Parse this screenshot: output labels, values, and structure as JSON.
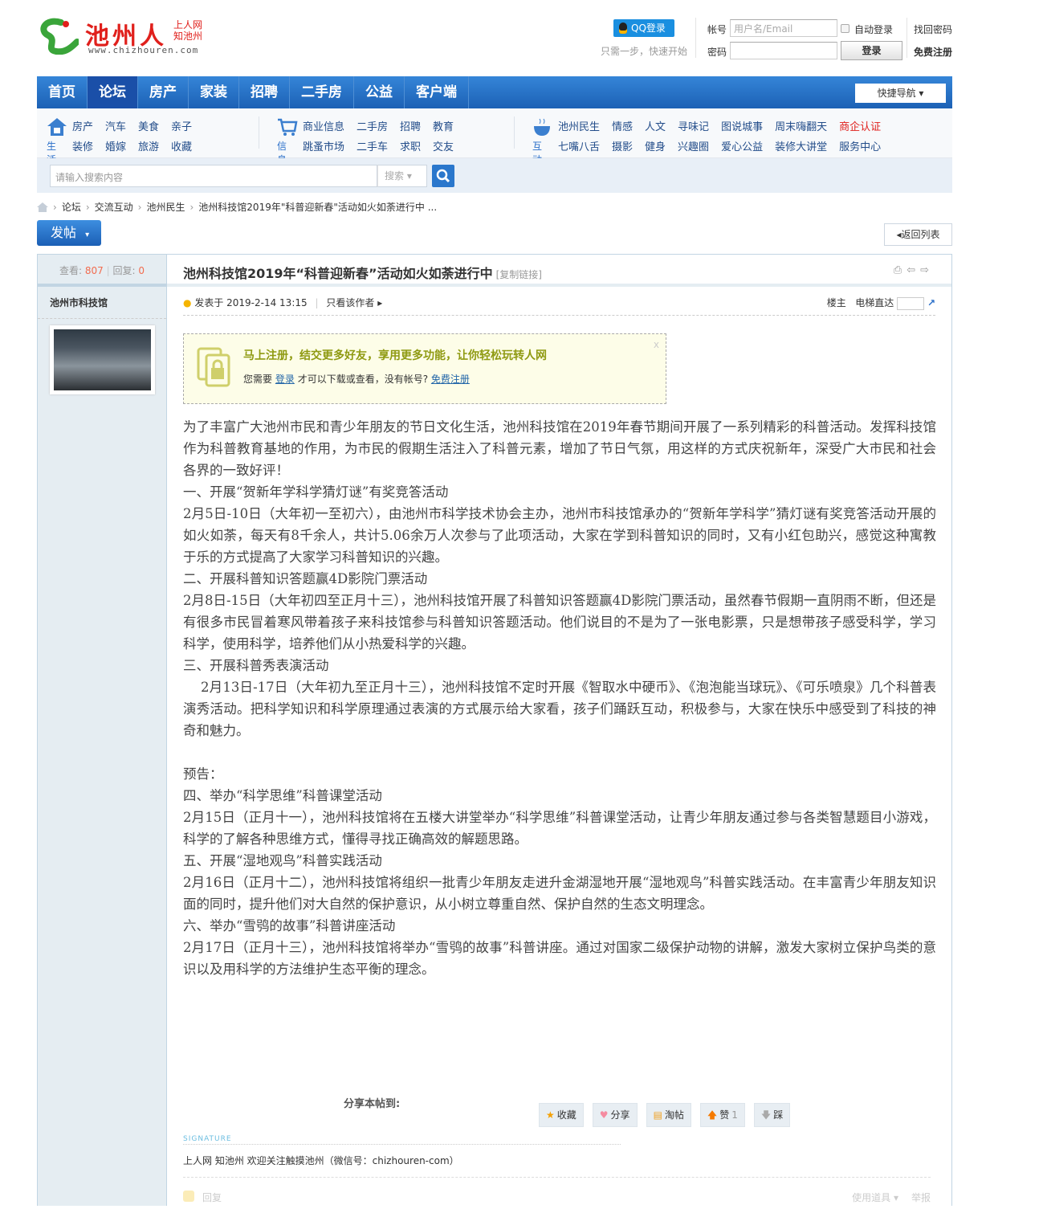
{
  "logo": {
    "name": "池州人",
    "sub1": "上人网",
    "sub2": "知池州",
    "url": "www.chizhouren.com"
  },
  "login": {
    "qq_label": "QQ登录",
    "qq_tip": "只需一步，快速开始",
    "account_label": "帐号",
    "account_placeholder": "用户名/Email",
    "password_label": "密码",
    "auto_login": "自动登录",
    "login_btn": "登录",
    "find_pwd": "找回密码",
    "register": "免费注册"
  },
  "nav": {
    "items": [
      "首页",
      "论坛",
      "房产",
      "家装",
      "招聘",
      "二手房",
      "公益",
      "客户端"
    ],
    "active": 1,
    "quick_nav": "快捷导航"
  },
  "subnav": {
    "life": {
      "label": "生活",
      "links": [
        "房产",
        "汽车",
        "美食",
        "亲子",
        "装修",
        "婚嫁",
        "旅游",
        "收藏"
      ]
    },
    "info": {
      "label": "信息",
      "links": [
        "商业信息",
        "二手房",
        "招聘",
        "教育",
        "跳蚤市场",
        "二手车",
        "求职",
        "交友"
      ]
    },
    "interact": {
      "label": "互动",
      "links": [
        "池州民生",
        "情感",
        "人文",
        "寻味记",
        "图说城事",
        "周末嗨翻天",
        "商企认证",
        "七嘴八舌",
        "摄影",
        "健身",
        "兴趣圈",
        "爱心公益",
        "装修大讲堂",
        "服务中心"
      ]
    }
  },
  "search": {
    "placeholder": "请输入搜索内容",
    "type": "搜索"
  },
  "breadcrumb": [
    "论坛",
    "交流互动",
    "池州民生",
    "池州科技馆2019年\"科普迎新春\"活动如火如荼进行中 ..."
  ],
  "post_btn": "发帖",
  "back_btn": "返回列表",
  "thread": {
    "views_label": "查看:",
    "views": "807",
    "replies_label": "回复:",
    "replies": "0",
    "title": "池州科技馆2019年“科普迎新春”活动如火如荼进行中",
    "copy_link": "[复制链接]",
    "author": "池州市科技馆",
    "posted": "发表于 2019-2-14 13:15",
    "only_author": "只看该作者",
    "floor": "楼主",
    "jump": "电梯直达",
    "register_box": {
      "headline": "马上注册，结交更多好友，享用更多功能，让你轻松玩转人网",
      "t1": "您需要",
      "login": "登录",
      "t2": "才可以下载或查看，没有帐号?",
      "register": "免费注册"
    },
    "paragraphs": [
      "为了丰富广大池州市民和青少年朋友的节日文化生活，池州科技馆在2019年春节期间开展了一系列精彩的科普活动。发挥科技馆作为科普教育基地的作用，为市民的假期生活注入了科普元素，增加了节日气氛，用这样的方式庆祝新年，深受广大市民和社会各界的一致好评！",
      "一、开展“贺新年学科学猜灯谜”有奖竞答活动",
      "2月5日-10日（大年初一至初六），由池州市科学技术协会主办，池州市科技馆承办的“贺新年学科学”猜灯谜有奖竞答活动开展的如火如荼，每天有8千余人，共计5.06余万人次参与了此项活动，大家在学到科普知识的同时，又有小红包助兴，感觉这种寓教于乐的方式提高了大家学习科普知识的兴趣。",
      "二、开展科普知识答题赢4D影院门票活动",
      "2月8日-15日（大年初四至正月十三），池州科技馆开展了科普知识答题赢4D影院门票活动，虽然春节假期一直阴雨不断，但还是有很多市民冒着寒风带着孩子来科技馆参与科普知识答题活动。他们说目的不是为了一张电影票，只是想带孩子感受科学，学习科学，使用科学，培养他们从小热爱科学的兴趣。",
      "三、开展科普秀表演活动",
      "　 2月13日-17日（大年初九至正月十三），池州科技馆不定时开展《智取水中硬币》、《泡泡能当球玩》、《可乐喷泉》几个科普表演秀活动。把科学知识和科学原理通过表演的方式展示给大家看，孩子们踊跃互动，积极参与，大家在快乐中感受到了科技的神奇和魅力。",
      "",
      "预告：",
      "四、举办“科学思维”科普课堂活动",
      "2月15日（正月十一），池州科技馆将在五楼大讲堂举办“科学思维”科普课堂活动，让青少年朋友通过参与各类智慧题目小游戏，科学的了解各种思维方式，懂得寻找正确高效的解题思路。",
      "五、开展“湿地观鸟”科普实践活动",
      "2月16日（正月十二），池州科技馆将组织一批青少年朋友走进升金湖湿地开展“湿地观鸟”科普实践活动。在丰富青少年朋友知识面的同时，提升他们对大自然的保护意识，从小树立尊重自然、保护自然的生态文明理念。",
      "六、举办“雪鸮的故事”科普讲座活动",
      "2月17日（正月十三），池州科技馆将举办“雪鸮的故事”科普讲座。通过对国家二级保护动物的讲解，激发大家树立保护鸟类的意识以及用科学的方法维护生态平衡的理念。"
    ],
    "share_label": "分享本帖到:",
    "actions": {
      "favorite": "收藏",
      "share": "分享",
      "tao": "淘帖",
      "like": "赞",
      "like_count": "1",
      "dislike": "踩"
    },
    "signature_label": "SIGNATURE",
    "signature": "上人网 知池州 欢迎关注触摸池州（微信号：chizhouren-com）",
    "reply": "回复",
    "tools": "使用道具",
    "report": "举报"
  }
}
